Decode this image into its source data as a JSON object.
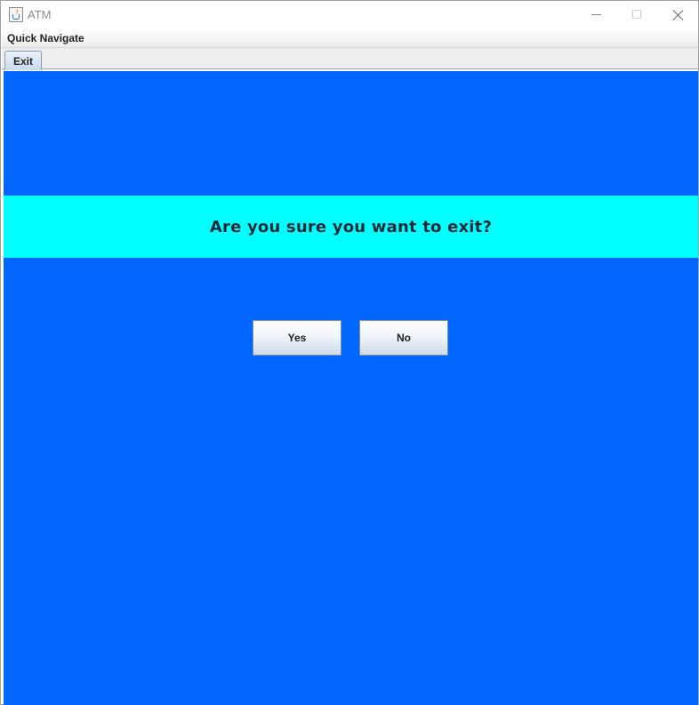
{
  "window": {
    "title": "ATM",
    "icon": "java-cup-icon",
    "controls": [
      "minimize-icon",
      "maximize-icon",
      "close-icon"
    ]
  },
  "menubar": {
    "items": [
      {
        "label": "Quick Navigate"
      }
    ]
  },
  "tabs": [
    {
      "label": "Exit",
      "selected": true
    }
  ],
  "content": {
    "prompt": "Are you sure you want to exit?",
    "yes_label": "Yes",
    "no_label": "No"
  },
  "colors": {
    "background": "#0066ff",
    "banner": "#00ffff",
    "prompt_text": "#1f2a38"
  }
}
